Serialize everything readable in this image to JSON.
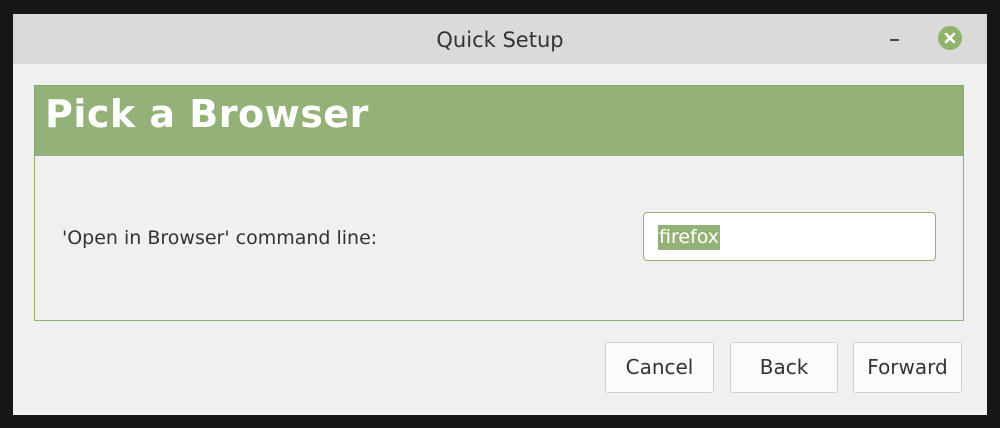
{
  "window": {
    "title": "Quick Setup",
    "controls": {
      "minimize_icon": "minimize-icon",
      "close_icon": "close-icon"
    }
  },
  "banner": {
    "title": "Pick a Browser"
  },
  "form": {
    "label": "'Open in Browser' command line:",
    "value": "firefox"
  },
  "buttons": {
    "cancel": "Cancel",
    "back": "Back",
    "forward": "Forward"
  },
  "colors": {
    "accent": "#94b277",
    "titlebar": "#dadada",
    "window_bg": "#f0f0f0",
    "backdrop": "#161616"
  }
}
